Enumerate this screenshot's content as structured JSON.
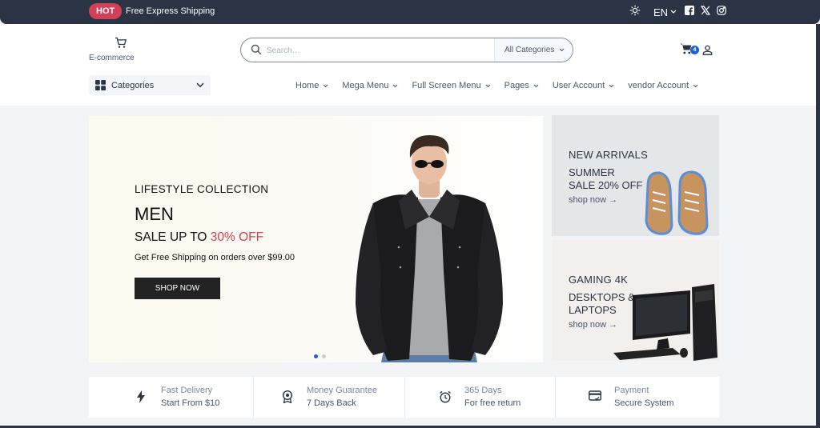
{
  "topbar": {
    "hot_label": "HOT",
    "shipping_text": "Free Express Shipping",
    "language": "EN"
  },
  "header": {
    "logo_text": "E-commerce",
    "search_placeholder": "Search…",
    "category_select": "All Categories",
    "cart_count": "4"
  },
  "nav": {
    "categories_label": "Categories",
    "items": [
      {
        "label": "Home"
      },
      {
        "label": "Mega Menu"
      },
      {
        "label": "Full Screen Menu"
      },
      {
        "label": "Pages"
      },
      {
        "label": "User Account"
      },
      {
        "label": "vendor Account"
      }
    ]
  },
  "hero": {
    "subtitle": "LIFESTYLE COLLECTION",
    "title": "MEN",
    "sale_prefix": "SALE UP TO",
    "sale_percent": "30% OFF",
    "shipping_note": "Get Free Shipping on orders over $99.00",
    "button_label": "SHOP NOW",
    "slides": 2,
    "active_slide": 1
  },
  "banners": [
    {
      "subtitle": "NEW ARRIVALS",
      "title_line1": "SUMMER",
      "title_line2": "SALE 20% OFF",
      "link": "shop now →"
    },
    {
      "subtitle": "GAMING 4K",
      "title_line1": "DESKTOPS &",
      "title_line2": "LAPTOPS",
      "link": "shop now →"
    }
  ],
  "services": [
    {
      "icon": "lightning-icon",
      "line1": "Fast Delivery",
      "line2": "Start From $10"
    },
    {
      "icon": "medal-icon",
      "line1": "Money Guarantee",
      "line2": "7 Days Back"
    },
    {
      "icon": "alarm-clock-icon",
      "line1": "365 Days",
      "line2": "For free return"
    },
    {
      "icon": "credit-card-icon",
      "line1": "Payment",
      "line2": "Secure System"
    }
  ],
  "colors": {
    "topbar_bg": "#2b3445",
    "hot_badge": "#d23f57",
    "accent_blue": "#1e60d8",
    "sale_red": "#d23f57"
  }
}
